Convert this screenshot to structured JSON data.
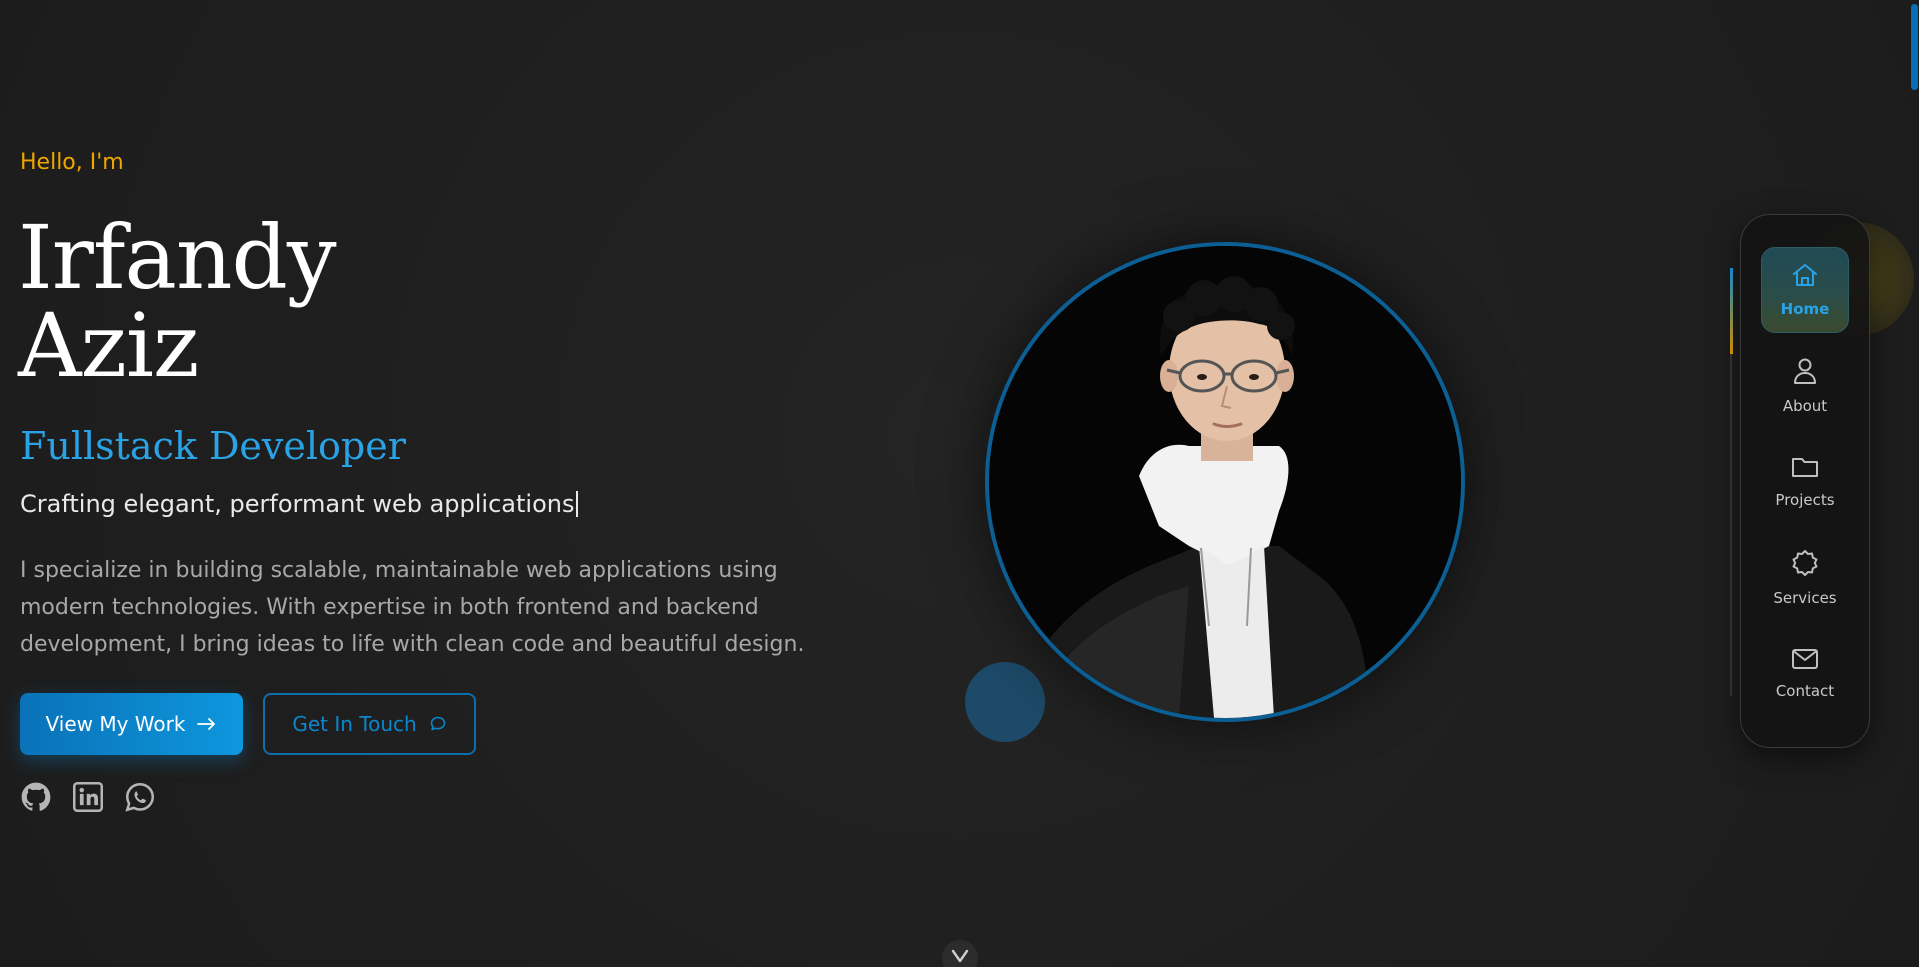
{
  "hero": {
    "greeting": "Hello, I'm",
    "first_name": "Irfandy",
    "last_name": "Aziz",
    "role": "Fullstack Developer",
    "tagline": "Crafting elegant, performant web applications",
    "bio": "I specialize in building scalable, maintainable web applications using modern technologies. With expertise in both frontend and backend development, I bring ideas to life with clean code and beautiful design.",
    "primary_button": "View My Work",
    "primary_button_icon": "arrow-right-icon",
    "secondary_button": "Get In Touch",
    "secondary_button_icon": "chat-bubble-icon"
  },
  "socials": [
    {
      "icon": "github-icon"
    },
    {
      "icon": "linkedin-icon"
    },
    {
      "icon": "whatsapp-icon"
    }
  ],
  "nav": {
    "items": [
      {
        "label": "Home",
        "icon": "home-icon",
        "active": true
      },
      {
        "label": "About",
        "icon": "user-icon",
        "active": false
      },
      {
        "label": "Projects",
        "icon": "folder-icon",
        "active": false
      },
      {
        "label": "Services",
        "icon": "badge-icon",
        "active": false
      },
      {
        "label": "Contact",
        "icon": "mail-icon",
        "active": false
      }
    ]
  },
  "colors": {
    "background": "#1f1f1f",
    "accent_blue": "#2aa3e6",
    "accent_orange": "#f0a500",
    "button_blue": "#0a72b8"
  }
}
